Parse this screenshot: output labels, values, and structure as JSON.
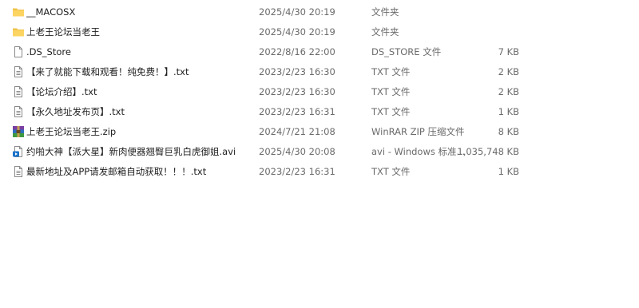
{
  "files": [
    {
      "name": "__MACOSX",
      "modified": "2025/4/30 20:19",
      "type": "文件夹",
      "size": "",
      "icon": "folder-icon"
    },
    {
      "name": "上老王论坛当老王",
      "modified": "2025/4/30 20:19",
      "type": "文件夹",
      "size": "",
      "icon": "folder-icon"
    },
    {
      "name": ".DS_Store",
      "modified": "2022/8/16 22:00",
      "type": "DS_STORE 文件",
      "size": "7 KB",
      "icon": "blank-file-icon"
    },
    {
      "name": "【来了就能下载和观看！纯免费！】.txt",
      "modified": "2023/2/23 16:30",
      "type": "TXT 文件",
      "size": "2 KB",
      "icon": "text-file-icon"
    },
    {
      "name": "【论坛介绍】.txt",
      "modified": "2023/2/23 16:30",
      "type": "TXT 文件",
      "size": "2 KB",
      "icon": "text-file-icon"
    },
    {
      "name": "【永久地址发布页】.txt",
      "modified": "2023/2/23 16:31",
      "type": "TXT 文件",
      "size": "1 KB",
      "icon": "text-file-icon"
    },
    {
      "name": "上老王论坛当老王.zip",
      "modified": "2024/7/21 21:08",
      "type": "WinRAR ZIP 压缩文件",
      "size": "8 KB",
      "icon": "winrar-archive-icon"
    },
    {
      "name": "约啪大神【派大星】新肉便器翘臀巨乳白虎御姐.avi",
      "modified": "2025/4/30 20:08",
      "type": "avi - Windows 标准...",
      "size": "1,035,748 KB",
      "icon": "video-file-icon"
    },
    {
      "name": "最新地址及APP请发邮箱自动获取！！！.txt",
      "modified": "2023/2/23 16:31",
      "type": "TXT 文件",
      "size": "1 KB",
      "icon": "text-file-icon"
    }
  ]
}
